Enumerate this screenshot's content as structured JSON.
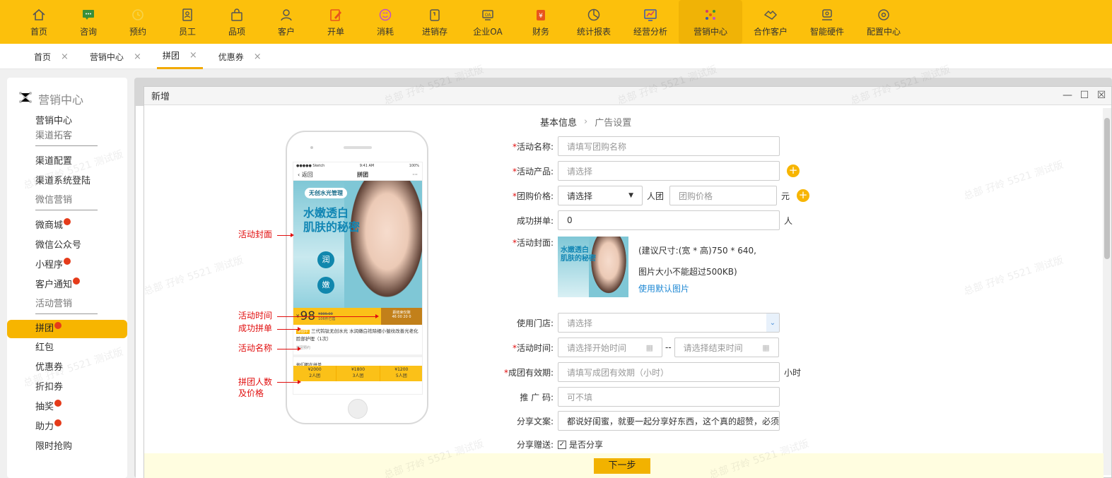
{
  "nav": {
    "items": [
      {
        "label": "首页",
        "icon": "home-icon"
      },
      {
        "label": "咨询",
        "icon": "chat-icon"
      },
      {
        "label": "预约",
        "icon": "clock-icon"
      },
      {
        "label": "员工",
        "icon": "id-card-icon"
      },
      {
        "label": "品项",
        "icon": "bag-icon"
      },
      {
        "label": "客户",
        "icon": "user-icon"
      },
      {
        "label": "开单",
        "icon": "edit-icon"
      },
      {
        "label": "消耗",
        "icon": "smile-icon"
      },
      {
        "label": "进销存",
        "icon": "box-icon"
      },
      {
        "label": "企业OA",
        "icon": "oa-icon"
      },
      {
        "label": "财务",
        "icon": "finance-icon"
      },
      {
        "label": "统计报表",
        "icon": "pie-chart-icon"
      },
      {
        "label": "经营分析",
        "icon": "analysis-icon"
      },
      {
        "label": "营销中心",
        "icon": "marketing-icon"
      },
      {
        "label": "合作客户",
        "icon": "handshake-icon"
      },
      {
        "label": "智能硬件",
        "icon": "hardware-icon"
      },
      {
        "label": "配置中心",
        "icon": "gear-icon"
      }
    ],
    "active_index": 13,
    "colors": {
      "bar": "#fcc00c",
      "active": "#f0b306"
    }
  },
  "tabs": [
    {
      "label": "首页"
    },
    {
      "label": "营销中心"
    },
    {
      "label": "拼团",
      "active": true
    },
    {
      "label": "优惠券"
    }
  ],
  "sidebar": {
    "title": "营销中心",
    "items": [
      {
        "label": "营销中心",
        "type": "item"
      },
      {
        "label": "渠道拓客",
        "type": "group"
      },
      {
        "label": "渠道配置",
        "type": "item"
      },
      {
        "label": "渠道系统登陆",
        "type": "item"
      },
      {
        "label": "微信营销",
        "type": "group"
      },
      {
        "label": "微商城",
        "type": "item",
        "hot": true
      },
      {
        "label": "微信公众号",
        "type": "item"
      },
      {
        "label": "小程序",
        "type": "item",
        "hot": true
      },
      {
        "label": "客户通知",
        "type": "item",
        "hot": true
      },
      {
        "label": "活动营销",
        "type": "group"
      },
      {
        "label": "拼团",
        "type": "item",
        "hot": true,
        "active": true
      },
      {
        "label": "红包",
        "type": "item"
      },
      {
        "label": "优惠券",
        "type": "item"
      },
      {
        "label": "折扣券",
        "type": "item"
      },
      {
        "label": "抽奖",
        "type": "item",
        "hot": true
      },
      {
        "label": "助力",
        "type": "item",
        "hot": true
      },
      {
        "label": "限时抢购",
        "type": "item"
      }
    ]
  },
  "modal": {
    "title": "新增",
    "steps": {
      "step1": "基本信息",
      "step2": "广告设置"
    },
    "phone": {
      "status_left": "●●●●● Sketch",
      "status_time": "9:41 AM",
      "status_right": "100%",
      "back": "返回",
      "title": "拼团",
      "more": "···",
      "brand": "无创水光管理",
      "headline1": "水嫩透白",
      "headline2": "肌肤的秘密",
      "dot1": "润",
      "dot2": "嫩",
      "yen": "¥",
      "price": "98",
      "old_price": "¥399.00",
      "joined": "106件已售",
      "countdown": "距结束仅剩",
      "countdown_value": "46 00 20 0",
      "tag": "拼团中",
      "product_name": "三代钨钛无创水光 水润嫩白祛除细小皱纹改善光老化脸部护理（1次）",
      "extra": "拼团预约",
      "others": "他们都在拼单",
      "tiers": [
        {
          "price": "¥2000",
          "people": "2人团"
        },
        {
          "price": "¥1800",
          "people": "3人团"
        },
        {
          "price": "¥1200",
          "people": "5人团"
        }
      ]
    },
    "annotations": {
      "cover": "活动封面",
      "time": "活动时间",
      "success": "成功拼单",
      "name": "活动名称",
      "tier1": "拼团人数",
      "tier2": "及价格"
    },
    "form": {
      "name_label": "活动名称:",
      "name_placeholder": "请填写团购名称",
      "product_label": "活动产品:",
      "product_placeholder": "请选择",
      "price_label": "团购价格:",
      "price_select": "请选择",
      "price_unit_people": "人团",
      "price_placeholder": "团购价格",
      "price_unit_yuan": "元",
      "success_label": "成功拼单:",
      "success_value": "0",
      "success_unit": "人",
      "cover_label": "活动封面:",
      "cover_thumb_text1": "水嫩透白",
      "cover_thumb_text2": "肌肤的秘密",
      "cover_size": "(建议尺寸:(宽 * 高)750 * 640,",
      "cover_limit": "图片大小不能超过500KB)",
      "cover_default": "使用默认图片",
      "store_label": "使用门店:",
      "store_placeholder": "请选择",
      "time_label": "活动时间:",
      "time_start": "请选择开始时间",
      "time_sep": "--",
      "time_end": "请选择结束时间",
      "valid_label": "成团有效期:",
      "valid_placeholder": "请填写成团有效期（小时）",
      "valid_unit": "小时",
      "promo_label": "推 广 码:",
      "promo_placeholder": "可不填",
      "share_text_label": "分享文案:",
      "share_text_value": "都说好闺蜜，就要一起分享好东西，这个真的超赞，必须",
      "share_gift_label": "分享赠送:",
      "share_gift_checkbox": "是否分享"
    },
    "next_button": "下一步"
  },
  "watermark": "总部 孖岭 5521 测试版"
}
